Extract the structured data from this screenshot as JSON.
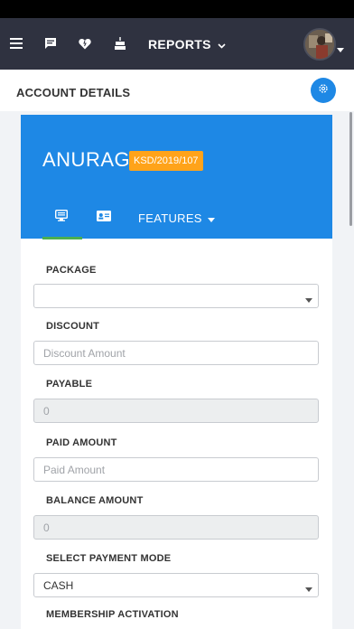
{
  "navbar": {
    "icons": [
      "menu-icon",
      "chat-icon",
      "heart-icon",
      "cake-icon"
    ],
    "reports_label": "REPORTS",
    "colors": {
      "background": "#2f3240",
      "text": "#ffffff"
    }
  },
  "header": {
    "title": "ACCOUNT DETAILS",
    "settings_icon": "gear-icon"
  },
  "account": {
    "name": "ANURAG",
    "code": "KSD/2019/107"
  },
  "tabs": {
    "icons": [
      "monitor-icon",
      "id-card-icon"
    ],
    "features_label": "FEATURES"
  },
  "form": {
    "package": {
      "label": "PACKAGE",
      "value": ""
    },
    "discount": {
      "label": "DISCOUNT",
      "placeholder": "Discount Amount"
    },
    "payable": {
      "label": "PAYABLE",
      "value": "0"
    },
    "paid_amount": {
      "label": "PAID AMOUNT",
      "placeholder": "Paid Amount"
    },
    "balance_amount": {
      "label": "BALANCE AMOUNT",
      "value": "0"
    },
    "payment_mode": {
      "label": "SELECT PAYMENT MODE",
      "value": "CASH"
    },
    "membership_activation": {
      "label": "MEMBERSHIP ACTIVATION"
    }
  },
  "colors": {
    "accent": "#1e88e5",
    "badge": "#ffa31a",
    "tab_indicator": "#4caf50"
  }
}
